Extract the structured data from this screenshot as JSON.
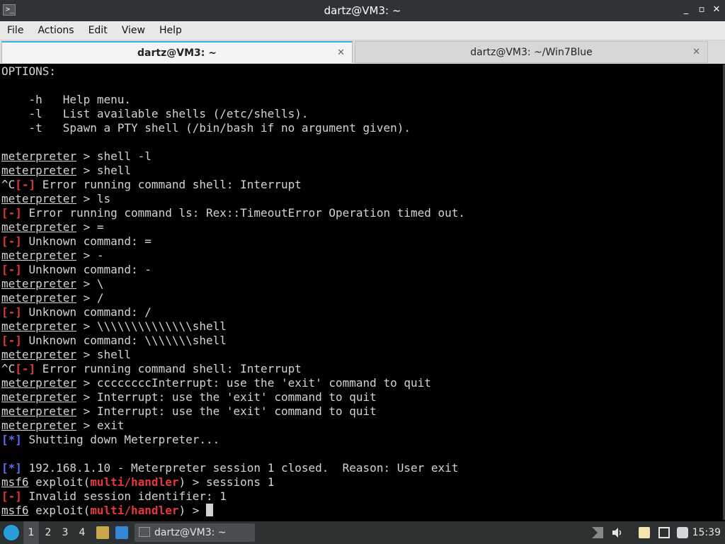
{
  "window": {
    "title": "dartz@VM3: ~",
    "min_icon": "_",
    "max_icon": "▫",
    "close_icon": "✕"
  },
  "menu": [
    "File",
    "Actions",
    "Edit",
    "View",
    "Help"
  ],
  "tabs": [
    {
      "label": "dartz@VM3: ~",
      "active": true
    },
    {
      "label": "dartz@VM3: ~/Win7Blue",
      "active": false
    }
  ],
  "terminal": {
    "lines": [
      [
        {
          "t": "OPTIONS:"
        }
      ],
      [],
      [
        {
          "t": "    -h   Help menu."
        }
      ],
      [
        {
          "t": "    -l   List available shells (/etc/shells)."
        }
      ],
      [
        {
          "t": "    -t   Spawn a PTY shell (/bin/bash if no argument given)."
        }
      ],
      [],
      [
        {
          "t": "meterpreter",
          "c": "u"
        },
        {
          "t": " > shell -l"
        }
      ],
      [
        {
          "t": "meterpreter",
          "c": "u"
        },
        {
          "t": " > shell"
        }
      ],
      [
        {
          "t": "^C"
        },
        {
          "t": "[-]",
          "c": "red"
        },
        {
          "t": " Error running command shell: Interrupt"
        }
      ],
      [
        {
          "t": "meterpreter",
          "c": "u"
        },
        {
          "t": " > ls"
        }
      ],
      [
        {
          "t": "[-]",
          "c": "red"
        },
        {
          "t": " Error running command ls: Rex::TimeoutError Operation timed out."
        }
      ],
      [
        {
          "t": "meterpreter",
          "c": "u"
        },
        {
          "t": " > ="
        }
      ],
      [
        {
          "t": "[-]",
          "c": "red"
        },
        {
          "t": " Unknown command: ="
        }
      ],
      [
        {
          "t": "meterpreter",
          "c": "u"
        },
        {
          "t": " > -"
        }
      ],
      [
        {
          "t": "[-]",
          "c": "red"
        },
        {
          "t": " Unknown command: -"
        }
      ],
      [
        {
          "t": "meterpreter",
          "c": "u"
        },
        {
          "t": " > \\"
        }
      ],
      [
        {
          "t": "meterpreter",
          "c": "u"
        },
        {
          "t": " > /"
        }
      ],
      [
        {
          "t": "[-]",
          "c": "red"
        },
        {
          "t": " Unknown command: /"
        }
      ],
      [
        {
          "t": "meterpreter",
          "c": "u"
        },
        {
          "t": " > \\\\\\\\\\\\\\\\\\\\\\\\\\\\shell"
        }
      ],
      [
        {
          "t": "[-]",
          "c": "red"
        },
        {
          "t": " Unknown command: \\\\\\\\\\\\\\shell"
        }
      ],
      [
        {
          "t": "meterpreter",
          "c": "u"
        },
        {
          "t": " > shell"
        }
      ],
      [
        {
          "t": "^C"
        },
        {
          "t": "[-]",
          "c": "red"
        },
        {
          "t": " Error running command shell: Interrupt"
        }
      ],
      [
        {
          "t": "meterpreter",
          "c": "u"
        },
        {
          "t": " > ccccccccInterrupt: use the 'exit' command to quit"
        }
      ],
      [
        {
          "t": "meterpreter",
          "c": "u"
        },
        {
          "t": " > Interrupt: use the 'exit' command to quit"
        }
      ],
      [
        {
          "t": "meterpreter",
          "c": "u"
        },
        {
          "t": " > Interrupt: use the 'exit' command to quit"
        }
      ],
      [
        {
          "t": "meterpreter",
          "c": "u"
        },
        {
          "t": " > exit"
        }
      ],
      [
        {
          "t": "[*]",
          "c": "blue"
        },
        {
          "t": " Shutting down Meterpreter..."
        }
      ],
      [],
      [
        {
          "t": "[*]",
          "c": "blue"
        },
        {
          "t": " 192.168.1.10 - Meterpreter session 1 closed.  Reason: User exit"
        }
      ],
      [
        {
          "t": "msf6",
          "c": "u"
        },
        {
          "t": " exploit("
        },
        {
          "t": "multi/handler",
          "c": "redb"
        },
        {
          "t": ") > sessions 1"
        }
      ],
      [
        {
          "t": "[-]",
          "c": "red"
        },
        {
          "t": " Invalid session identifier: 1"
        }
      ],
      [
        {
          "t": "msf6",
          "c": "u"
        },
        {
          "t": " exploit("
        },
        {
          "t": "multi/handler",
          "c": "redb"
        },
        {
          "t": ") > "
        },
        {
          "t": "",
          "c": "cursor"
        }
      ]
    ]
  },
  "taskbar": {
    "workspaces": [
      "1",
      "2",
      "3",
      "4"
    ],
    "task_label": "dartz@VM3: ~",
    "clock": "15:39"
  },
  "colors": {
    "accent": "#3daee9",
    "error": "#e5383b",
    "info": "#5c6ef0"
  }
}
